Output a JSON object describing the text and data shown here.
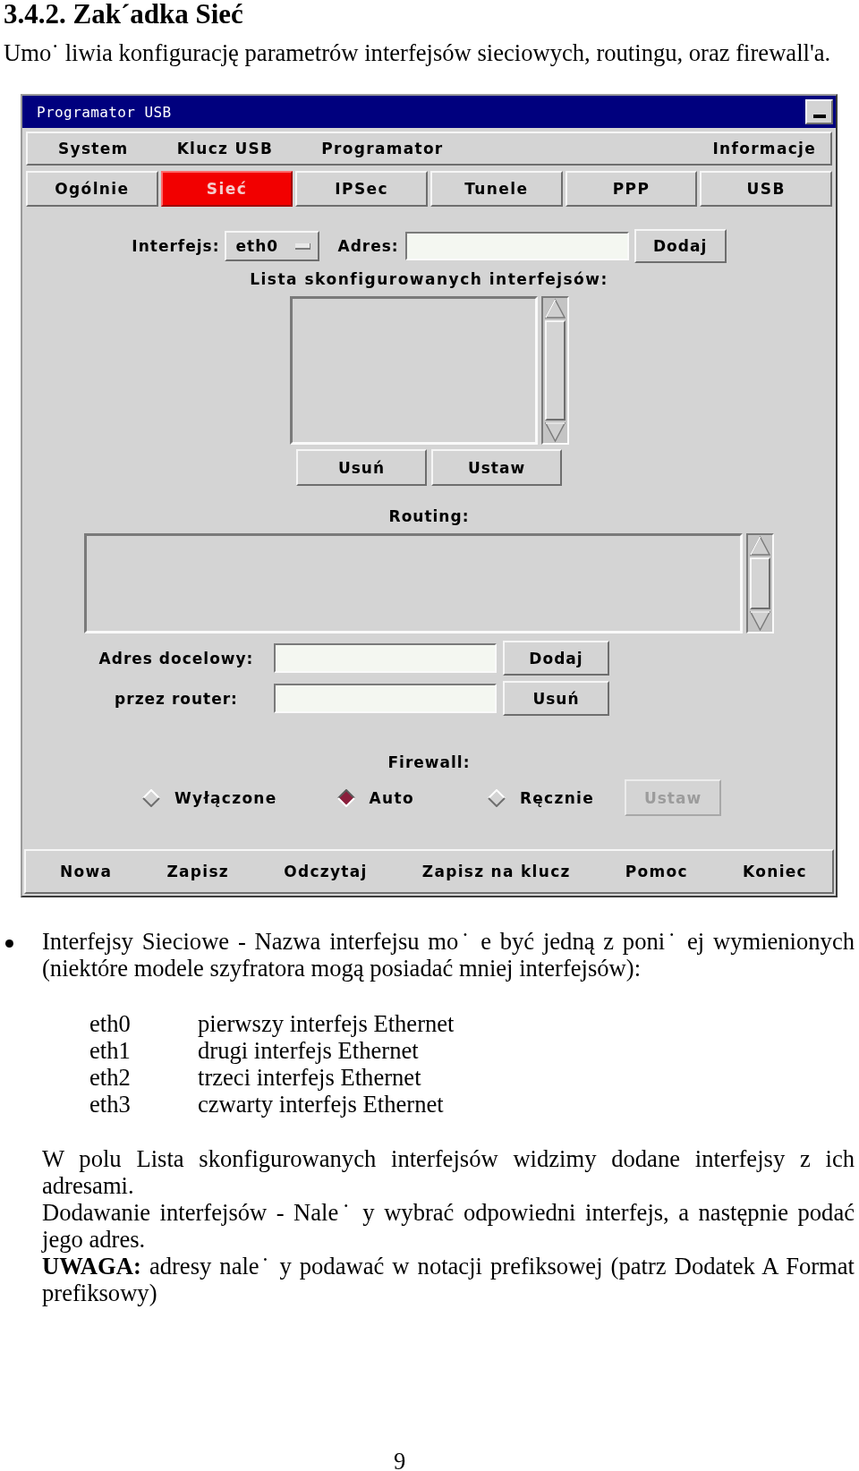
{
  "heading": "3.4.2. Zak´adka Sieć",
  "intro": "Umo˙ liwia konfigurację parametrów interfejsów sieciowych, routingu, oraz firewall'a.",
  "window": {
    "title": "Programator USB",
    "menu": [
      "System",
      "Klucz USB",
      "Programator",
      "Informacje"
    ],
    "tabs": [
      {
        "label": "Ogólnie",
        "selected": false
      },
      {
        "label": "Sieć",
        "selected": true
      },
      {
        "label": "IPSec",
        "selected": false
      },
      {
        "label": "Tunele",
        "selected": false
      },
      {
        "label": "PPP",
        "selected": false
      },
      {
        "label": "USB",
        "selected": false
      }
    ],
    "interface_row": {
      "label": "Interfejs:",
      "interface": "eth0",
      "address_label": "Adres:",
      "add_button": "Dodaj"
    },
    "interface_list": {
      "label": "Lista skonfigurowanych interfejsów:",
      "remove_button": "Usuń",
      "set_button": "Ustaw"
    },
    "routing": {
      "label": "Routing:",
      "destination_label": "Adres docelowy:",
      "router_label": "przez router:",
      "add_button": "Dodaj",
      "remove_button": "Usuń"
    },
    "firewall": {
      "label": "Firewall:",
      "options": [
        {
          "label": "Wyłączone",
          "selected": false
        },
        {
          "label": "Auto",
          "selected": true
        },
        {
          "label": "Ręcznie",
          "selected": false
        }
      ],
      "set_button": {
        "label": "Ustaw",
        "disabled": true
      }
    },
    "bottom_bar": [
      "Nowa",
      "Zapisz",
      "Odczytaj",
      "Zapisz na klucz",
      "Pomoc",
      "Koniec"
    ]
  },
  "bullet_text": "Interfejsy Sieciowe - Nazwa interfejsu mo˙ e być jedną z poni˙ ej wymienionych (niektóre modele szyfratora mogą posiadać mniej interfejsów):",
  "interfaces": [
    {
      "name": "eth0",
      "description": "pierwszy interfejs Ethernet"
    },
    {
      "name": "eth1",
      "description": "drugi interfejs Ethernet"
    },
    {
      "name": "eth2",
      "description": "trzeci interfejs Ethernet"
    },
    {
      "name": "eth3",
      "description": "czwarty interfejs Ethernet"
    }
  ],
  "paragraphs": [
    "W polu Lista skonfigurowanych interfejsów widzimy dodane interfejsy z ich adresami.",
    "Dodawanie interfejsów - Nale˙ y wybrać odpowiedni interfejs, a następnie podać jego adres.",
    "**UWAGA:** adresy nale˙ y podawać w notacji prefiksowej (patrz Dodatek A Format prefiksowy)"
  ],
  "page_number": "9"
}
